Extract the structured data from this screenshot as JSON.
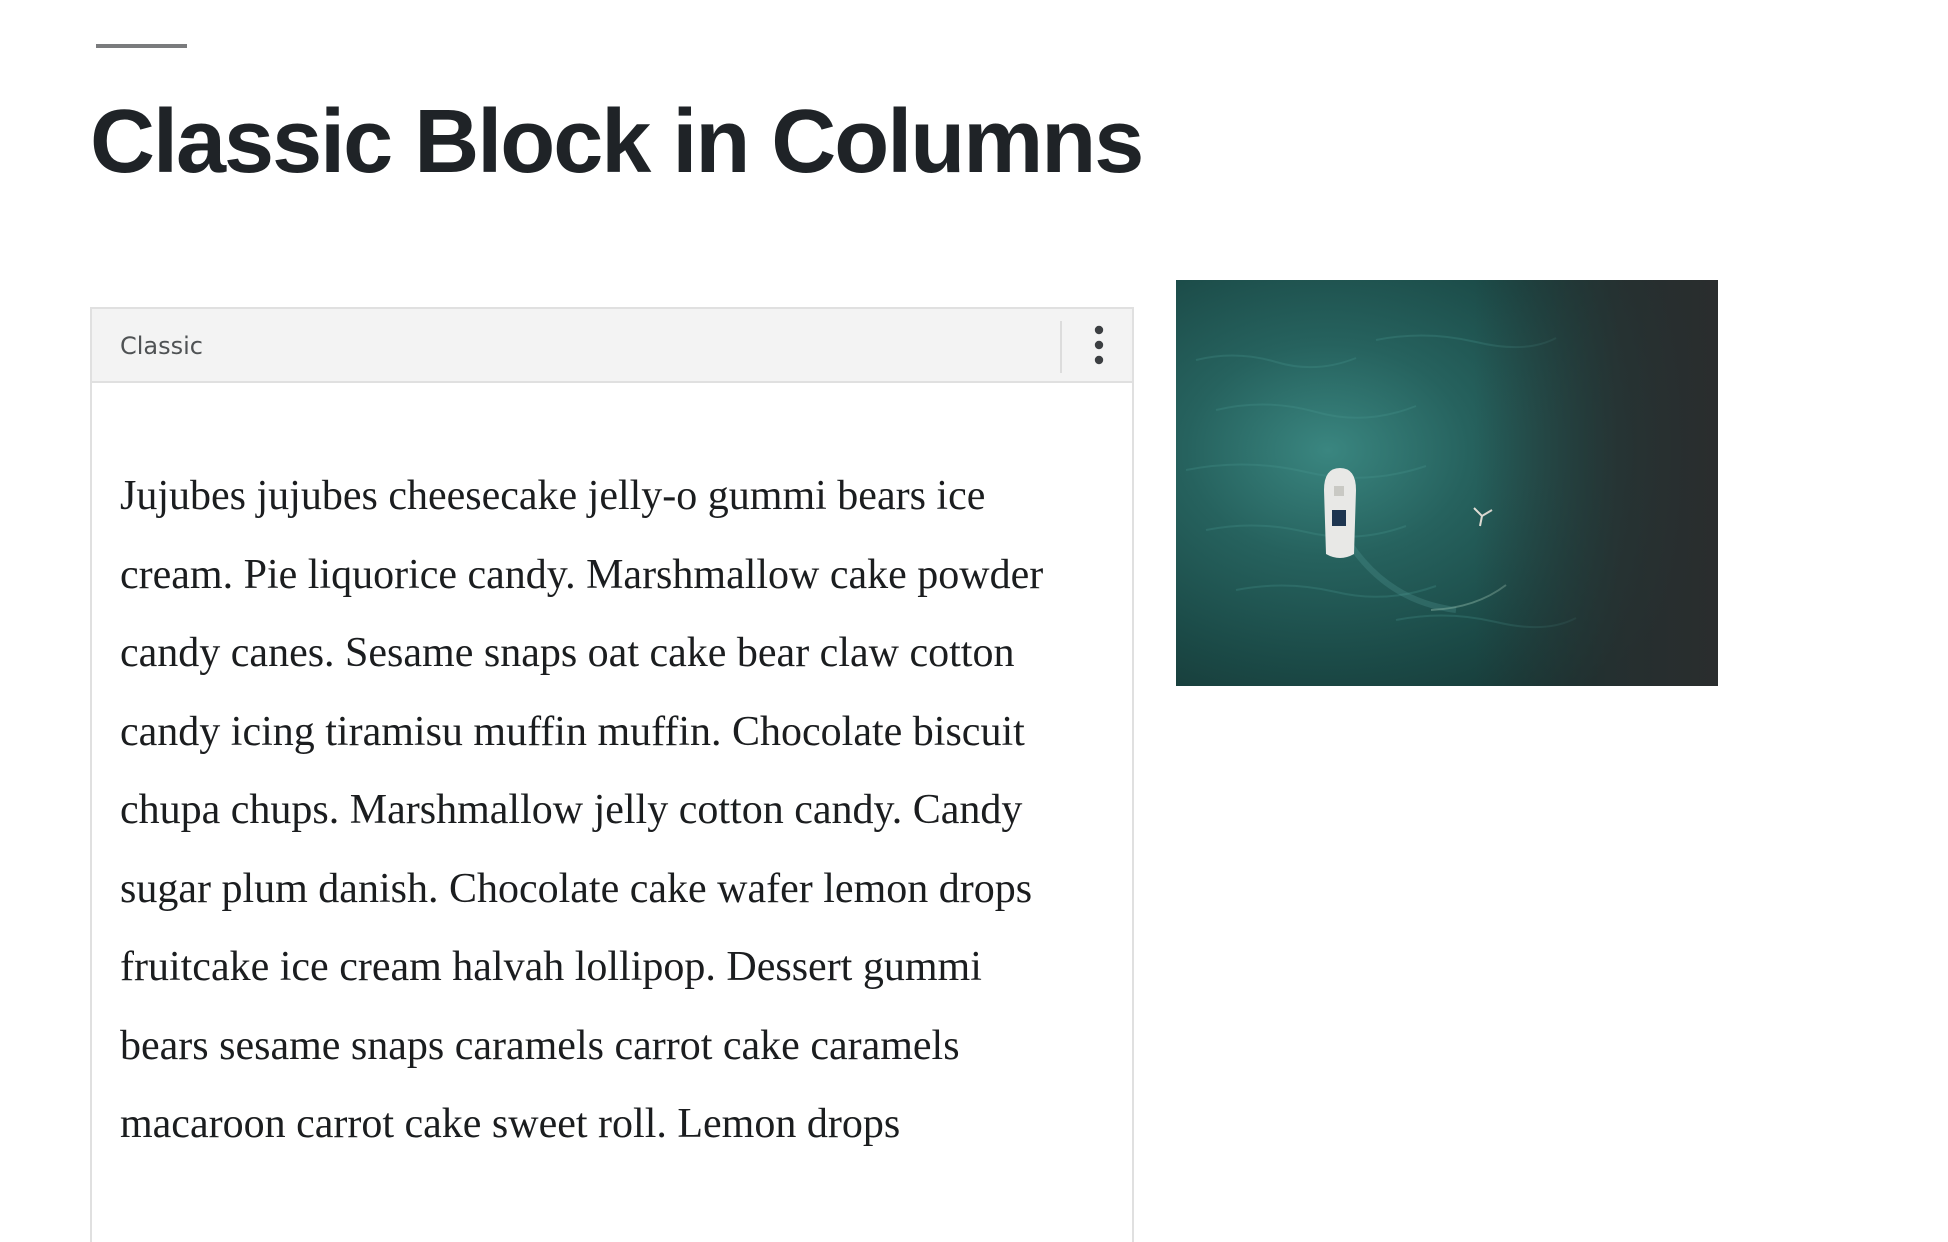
{
  "page": {
    "title": "Classic Block in Columns"
  },
  "classic_block": {
    "label": "Classic",
    "more_options_icon": "vertical-ellipsis-icon",
    "content": "Jujubes jujubes cheesecake jelly-o gummi bears ice cream. Pie liquorice candy. Marshmallow cake powder candy canes. Sesame snaps oat cake bear claw cotton candy icing tiramisu muffin muffin. Chocolate biscuit chupa chups. Marshmallow jelly cotton candy. Candy sugar plum danish. Chocolate cake wafer lemon drops fruitcake ice cream halvah lollipop. Dessert gummi bears sesame snaps caramels carrot cake caramels macaroon carrot cake sweet roll. Lemon drops"
  },
  "image": {
    "subject": "aerial view of a boat on teal water",
    "colors": {
      "water_light": "#2f7d78",
      "water_dark": "#17403e",
      "shadow": "#2a2d2e"
    }
  }
}
